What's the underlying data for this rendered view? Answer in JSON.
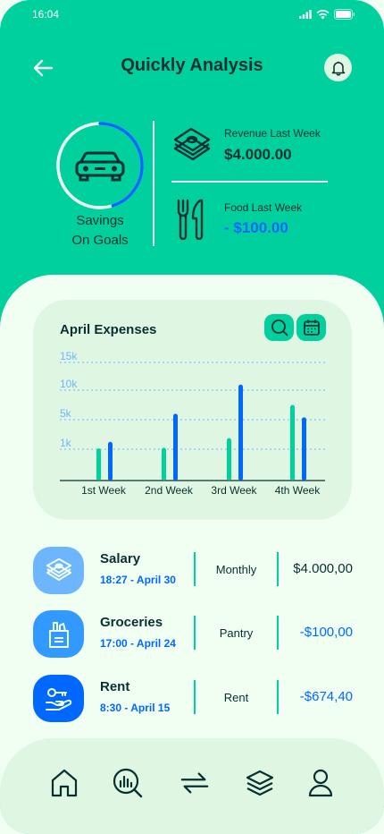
{
  "status_bar": {
    "time": "16:04"
  },
  "header": {
    "title": "Quickly Analysis"
  },
  "goal": {
    "label_line1": "Savings",
    "label_line2": "On Goals",
    "progress": 0.45
  },
  "stats": [
    {
      "title": "Revenue Last Week",
      "value": "$4.000.00"
    },
    {
      "title": "Food Last Week",
      "value": "- $100.00"
    }
  ],
  "chart_data": {
    "type": "bar",
    "title": "April Expenses",
    "categories": [
      "1st Week",
      "2nd Week",
      "3rd Week",
      "4th Week"
    ],
    "y_ticks": [
      "15k",
      "10k",
      "5k",
      "1k"
    ],
    "y_tick_values": [
      15000,
      10000,
      5000,
      1000
    ],
    "series": [
      {
        "color": "#00d09e",
        "values": [
          1100,
          1200,
          2500,
          7500
        ]
      },
      {
        "color": "#0068ff",
        "values": [
          2000,
          6000,
          11000,
          5400
        ]
      }
    ]
  },
  "transactions": [
    {
      "name": "Salary",
      "time": "18:27 - April 30",
      "category": "Monthly",
      "amount": "$4.000,00",
      "negative": false,
      "icon": "money-icon",
      "icon_bg": "#6db6fe"
    },
    {
      "name": "Groceries",
      "time": "17:00 - April 24",
      "category": "Pantry",
      "amount": "-$100,00",
      "negative": true,
      "icon": "grocery-bag-icon",
      "icon_bg": "#3299ff"
    },
    {
      "name": "Rent",
      "time": "8:30 - April 15",
      "category": "Rent",
      "amount": "-$674,40",
      "negative": true,
      "icon": "key-hand-icon",
      "icon_bg": "#0068ff"
    }
  ],
  "colors": {
    "primary": "#00d09e",
    "accent_blue": "#0068ff",
    "background": "#f1fff3",
    "card": "#dff7e2",
    "text": "#093030"
  },
  "nav_icons": [
    "home-icon",
    "analysis-icon",
    "transfer-icon",
    "layers-icon",
    "profile-icon"
  ]
}
